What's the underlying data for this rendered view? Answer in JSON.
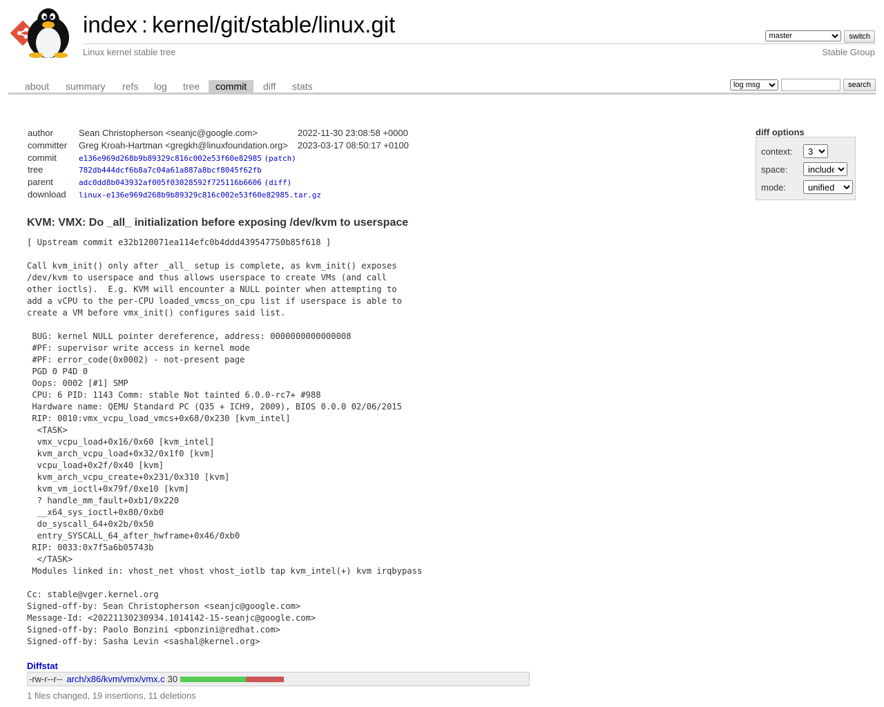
{
  "header": {
    "title_prefix": "index",
    "title_separator": ":",
    "repo_path": "kernel/git/stable/linux.git",
    "description": "Linux kernel stable tree",
    "owner": "Stable Group",
    "branch": "master",
    "switch_label": "switch"
  },
  "tabs": [
    "about",
    "summary",
    "refs",
    "log",
    "tree",
    "commit",
    "diff",
    "stats"
  ],
  "active_tab": "commit",
  "search": {
    "type": "log msg",
    "button": "search"
  },
  "commit": {
    "author_label": "author",
    "author": "Sean Christopherson <seanjc@google.com>",
    "author_date": "2022-11-30 23:08:58 +0000",
    "committer_label": "committer",
    "committer": "Greg Kroah-Hartman <gregkh@linuxfoundation.org>",
    "committer_date": "2023-03-17 08:50:17 +0100",
    "commit_label": "commit",
    "commit_hash": "e136e969d268b9b89329c816c002e53f60e82985",
    "patch_label": "patch",
    "tree_label": "tree",
    "tree_hash": "782db444dcf6b8a7c04a61a887a8bcf8045f62fb",
    "parent_label": "parent",
    "parent_hash": "adc0dd8b043932af005f03028592f725116b6606",
    "diff_label": "diff",
    "download_label": "download",
    "download_file": "linux-e136e969d268b9b89329c816c002e53f60e82985.tar.gz"
  },
  "diff_options": {
    "title": "diff options",
    "context_label": "context:",
    "context_value": "3",
    "space_label": "space:",
    "space_value": "include",
    "mode_label": "mode:",
    "mode_value": "unified"
  },
  "subject": "KVM: VMX: Do _all_ initialization before exposing /dev/kvm to userspace",
  "message": "[ Upstream commit e32b120071ea114efc0b4ddd439547750b85f618 ]\n\nCall kvm_init() only after _all_ setup is complete, as kvm_init() exposes\n/dev/kvm to userspace and thus allows userspace to create VMs (and call\nother ioctls).  E.g. KVM will encounter a NULL pointer when attempting to\nadd a vCPU to the per-CPU loaded_vmcss_on_cpu list if userspace is able to\ncreate a VM before vmx_init() configures said list.\n\n BUG: kernel NULL pointer dereference, address: 0000000000000008\n #PF: supervisor write access in kernel mode\n #PF: error_code(0x0002) - not-present page\n PGD 0 P4D 0\n Oops: 0002 [#1] SMP\n CPU: 6 PID: 1143 Comm: stable Not tainted 6.0.0-rc7+ #988\n Hardware name: QEMU Standard PC (Q35 + ICH9, 2009), BIOS 0.0.0 02/06/2015\n RIP: 0010:vmx_vcpu_load_vmcs+0x68/0x230 [kvm_intel]\n  <TASK>\n  vmx_vcpu_load+0x16/0x60 [kvm_intel]\n  kvm_arch_vcpu_load+0x32/0x1f0 [kvm]\n  vcpu_load+0x2f/0x40 [kvm]\n  kvm_arch_vcpu_create+0x231/0x310 [kvm]\n  kvm_vm_ioctl+0x79f/0xe10 [kvm]\n  ? handle_mm_fault+0xb1/0x220\n  __x64_sys_ioctl+0x80/0xb0\n  do_syscall_64+0x2b/0x50\n  entry_SYSCALL_64_after_hwframe+0x46/0xb0\n RIP: 0033:0x7f5a6b05743b\n  </TASK>\n Modules linked in: vhost_net vhost vhost_iotlb tap kvm_intel(+) kvm irqbypass\n\nCc: stable@vger.kernel.org\nSigned-off-by: Sean Christopherson <seanjc@google.com>\nMessage-Id: <20221130230934.1014142-15-seanjc@google.com>\nSigned-off-by: Paolo Bonzini <pbonzini@redhat.com>\nSigned-off-by: Sasha Levin <sashal@kernel.org>",
  "diffstat": {
    "header": "Diffstat",
    "mode": "-rw-r--r--",
    "file": "arch/x86/kvm/vmx/vmx.c",
    "changes": "30",
    "insertions": 19,
    "deletions": 11,
    "summary": "1 files changed, 19 insertions, 11 deletions",
    "insert_color": "#55cc55",
    "delete_color": "#cc5555"
  }
}
